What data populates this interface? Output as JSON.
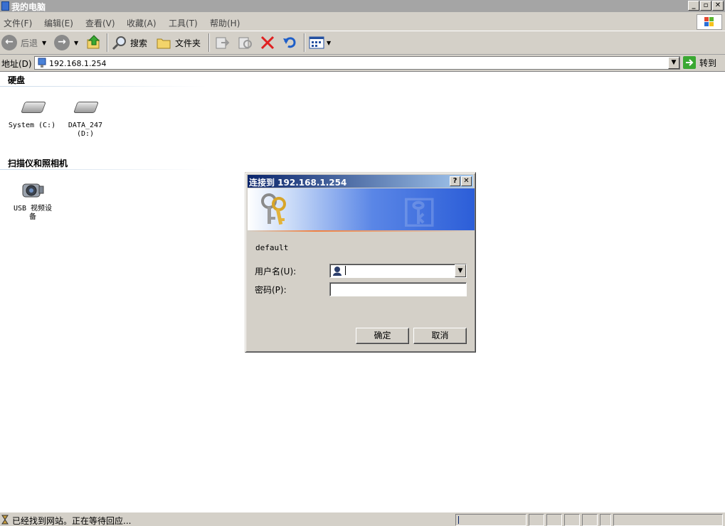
{
  "window": {
    "title": "我的电脑",
    "minimize": "_",
    "restore": "▫",
    "close": "✕"
  },
  "menu": [
    {
      "label": "文件(F)"
    },
    {
      "label": "编辑(E)"
    },
    {
      "label": "查看(V)"
    },
    {
      "label": "收藏(A)"
    },
    {
      "label": "工具(T)"
    },
    {
      "label": "帮助(H)"
    }
  ],
  "toolbar": {
    "back": "后退",
    "search": "搜索",
    "folders": "文件夹"
  },
  "address": {
    "label": "地址(D)",
    "value": "192.168.1.254",
    "go": "转到"
  },
  "groups": {
    "disks": {
      "title": "硬盘",
      "items": [
        {
          "label": "System (C:)"
        },
        {
          "label": "DATA_247\n(D:)"
        }
      ]
    },
    "scanners": {
      "title": "扫描仪和照相机",
      "items": [
        {
          "label": "USB 视频设\n备"
        }
      ]
    }
  },
  "dialog": {
    "title": "连接到 192.168.1.254",
    "help": "?",
    "close": "✕",
    "realm": "default",
    "username_label": "用户名(U):",
    "username_value": "",
    "password_label": "密码(P):",
    "password_value": "",
    "ok": "确定",
    "cancel": "取消"
  },
  "status": {
    "text": "已经找到网站。正在等待回应..."
  }
}
